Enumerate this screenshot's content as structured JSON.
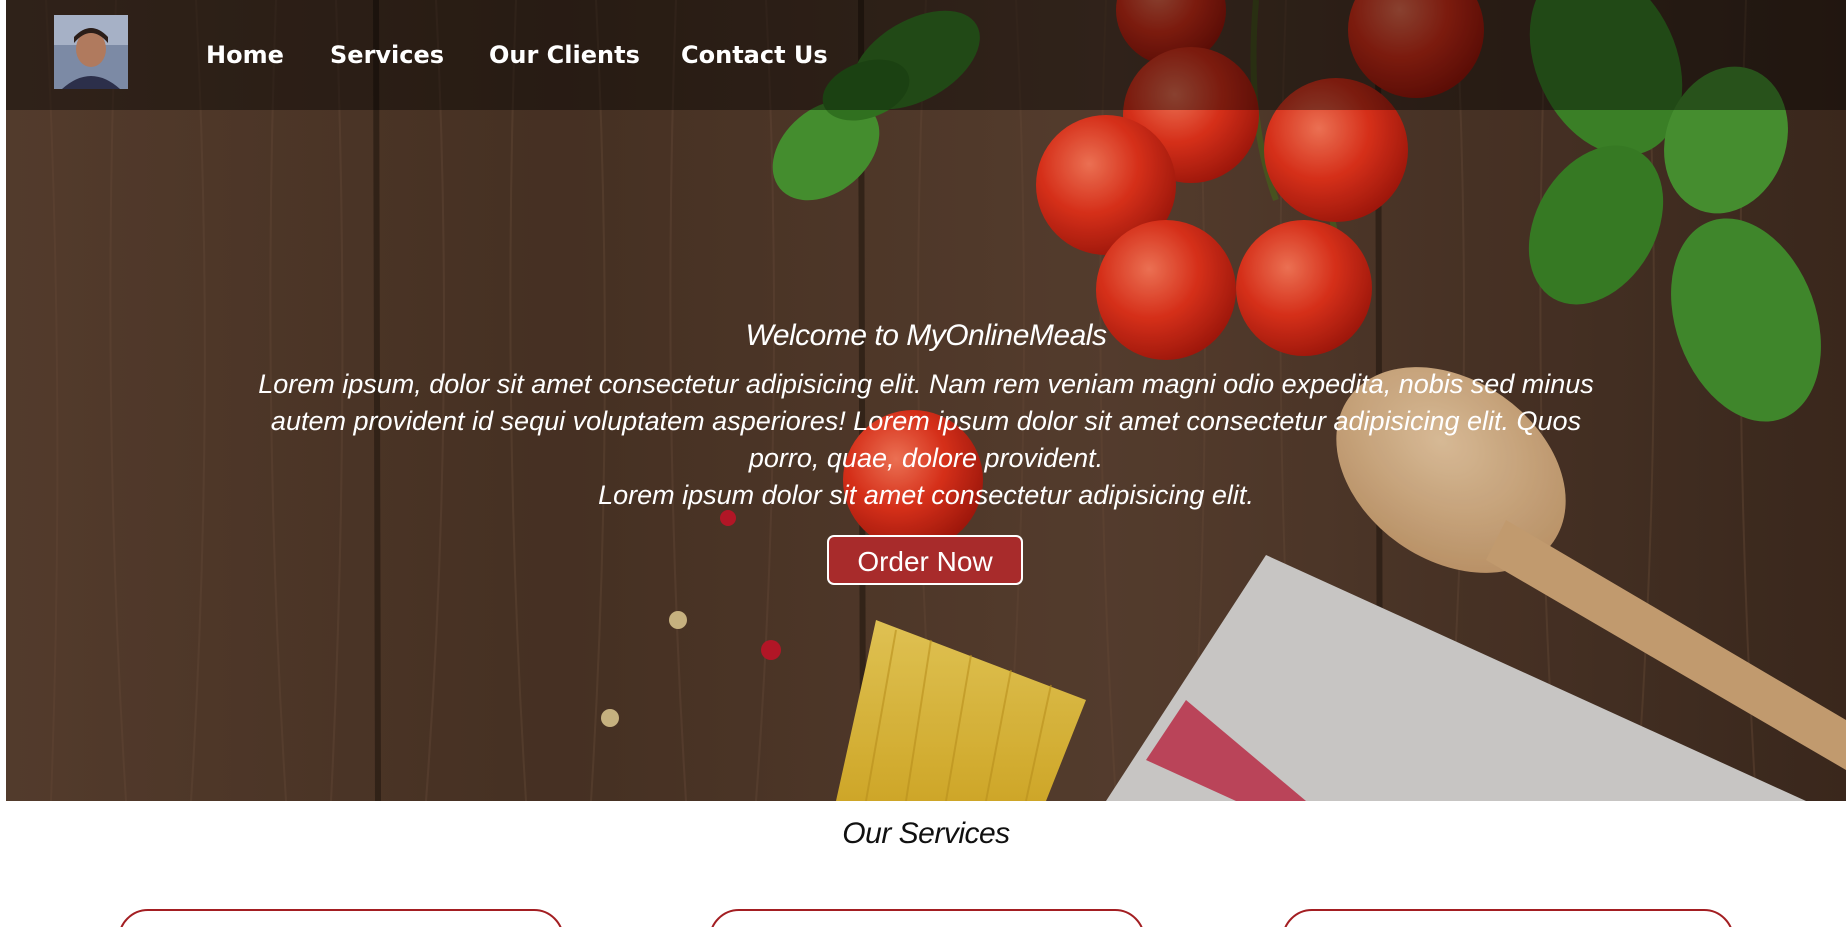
{
  "nav": {
    "items": [
      {
        "label": "Home"
      },
      {
        "label": "Services"
      },
      {
        "label": "Our Clients"
      },
      {
        "label": "Contact Us"
      }
    ]
  },
  "hero": {
    "title": "Welcome to MyOnlineMeals",
    "paragraph_1": "Lorem ipsum, dolor sit amet consectetur adipisicing elit. Nam rem veniam magni odio expedita, nobis sed minus autem provident id sequi voluptatem asperiores! Lorem ipsum dolor sit amet consectetur adipisicing elit. Quos porro, quae, dolore provident.",
    "paragraph_2": "Lorem ipsum dolor sit amet consectetur adipisicing elit.",
    "order_button": "Order Now"
  },
  "services": {
    "title": "Our Services"
  },
  "colors": {
    "accent": "#a82b2b",
    "card_border": "#a31e22",
    "wood": "#4a3426"
  }
}
